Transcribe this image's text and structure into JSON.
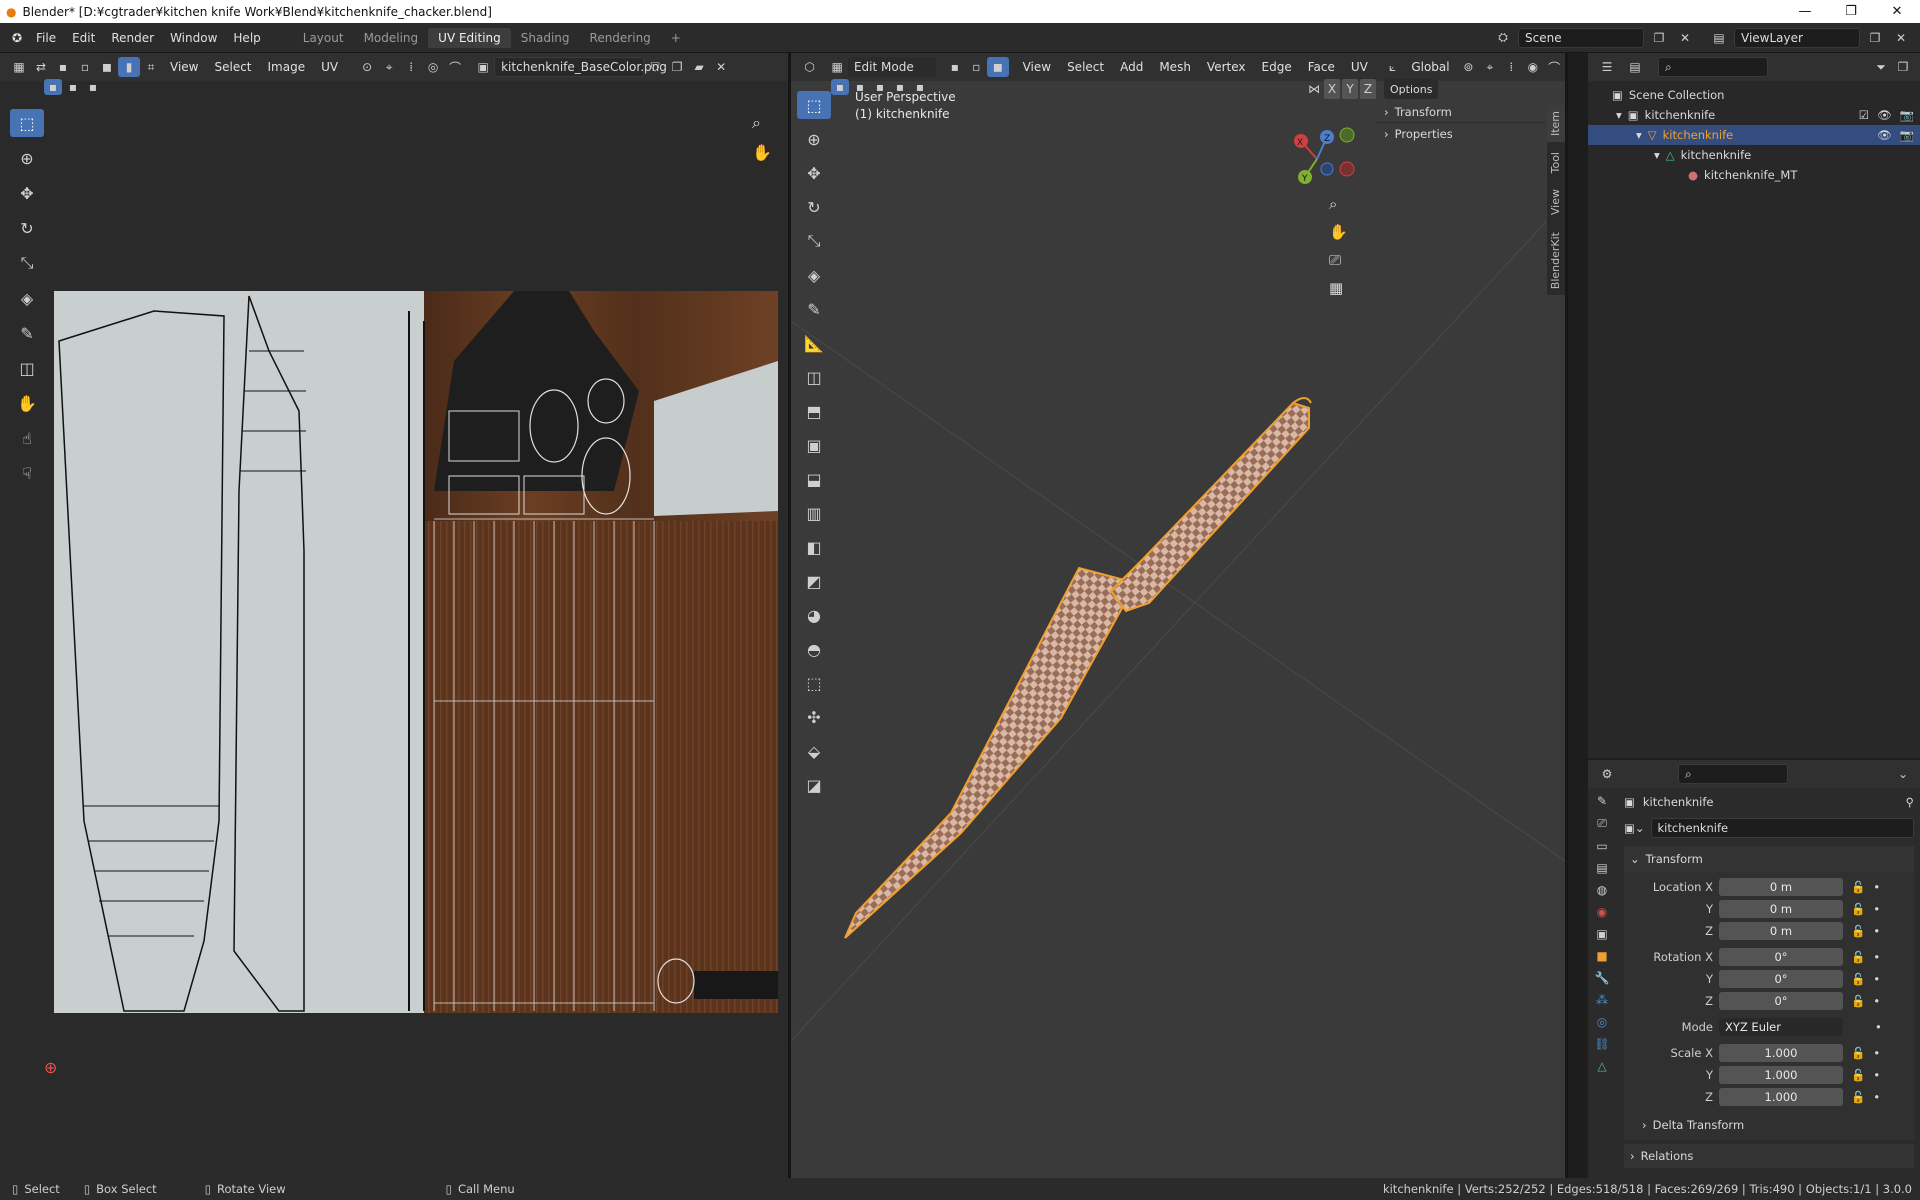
{
  "window": {
    "title": "Blender* [D:¥cgtrader¥kitchen knife Work¥Blend¥kitchenknife_chacker.blend]",
    "minimize": "—",
    "maximize": "❐",
    "close": "✕"
  },
  "menubar": {
    "menus": [
      "File",
      "Edit",
      "Render",
      "Window",
      "Help"
    ],
    "workspaces": [
      "Layout",
      "Modeling",
      "UV Editing",
      "Shading",
      "Rendering"
    ],
    "active_workspace": "UV Editing",
    "add_tab": "+",
    "scene": "Scene",
    "view_layer": "ViewLayer"
  },
  "uv_editor": {
    "menus": [
      "View",
      "Select",
      "Image",
      "UV"
    ],
    "image_name": "kitchenknife_BaseColor.png"
  },
  "viewport": {
    "mode": "Edit Mode",
    "menus": [
      "View",
      "Select",
      "Add",
      "Mesh",
      "Vertex",
      "Edge",
      "Face",
      "UV"
    ],
    "orientation": "Global",
    "perspective": "User Perspective",
    "object_label": "(1) kitchenknife",
    "axes": {
      "x": "X",
      "y": "Y",
      "z": "Z"
    },
    "options": "Options",
    "sidebar_panels": [
      "Transform",
      "Properties"
    ],
    "sidebar_tabs": [
      "Item",
      "Tool",
      "View",
      "BlenderKit"
    ]
  },
  "outliner": {
    "items": [
      {
        "label": "Scene Collection",
        "depth": 0
      },
      {
        "label": "kitchenknife",
        "depth": 1
      },
      {
        "label": "kitchenknife",
        "depth": 2,
        "selected": true
      },
      {
        "label": "kitchenknife",
        "depth": 3
      },
      {
        "label": "kitchenknife_MT",
        "depth": 4
      }
    ]
  },
  "properties": {
    "object_name": "kitchenknife",
    "data_name": "kitchenknife",
    "transform_title": "Transform",
    "location": {
      "label": "Location X",
      "x": "0 m",
      "y": "0 m",
      "z": "0 m"
    },
    "rotation": {
      "label": "Rotation X",
      "x": "0°",
      "y": "0°",
      "z": "0°"
    },
    "mode_label": "Mode",
    "mode_value": "XYZ Euler",
    "scale": {
      "label": "Scale X",
      "x": "1.000",
      "y": "1.000",
      "z": "1.000"
    },
    "axis_y": "Y",
    "axis_z": "Z",
    "delta_transform": "Delta Transform",
    "relations": "Relations"
  },
  "statusbar": {
    "select": "Select",
    "box_select": "Box Select",
    "rotate_view": "Rotate View",
    "call_menu": "Call Menu",
    "stats": "kitchenknife | Verts:252/252 | Edges:518/518 | Faces:269/269 | Tris:490 | Objects:1/1 | 3.0.0"
  },
  "colors": {
    "accent": "#4772b3",
    "selected_orange": "#f0a030",
    "background": "#2b2b2b"
  }
}
